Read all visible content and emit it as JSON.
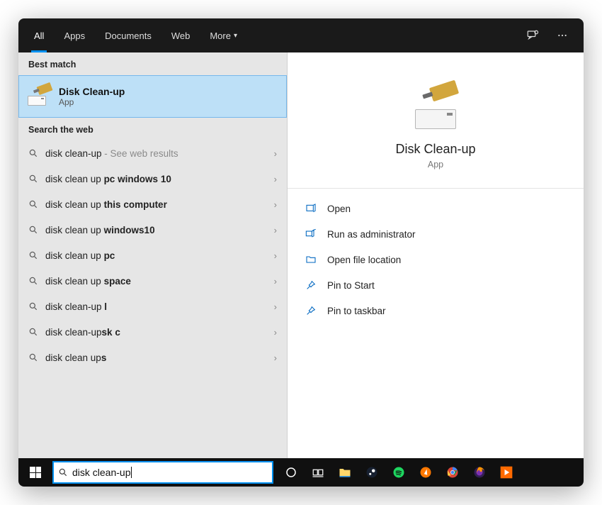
{
  "tabs": {
    "items": [
      "All",
      "Apps",
      "Documents",
      "Web",
      "More"
    ],
    "active_index": 0
  },
  "left": {
    "best_label": "Best match",
    "best": {
      "title": "Disk Clean-up",
      "sub": "App"
    },
    "web_label": "Search the web",
    "suggestions": [
      {
        "pre": "disk clean-up",
        "bold": "",
        "hint": " - See web results"
      },
      {
        "pre": "disk clean up ",
        "bold": "pc windows 10",
        "hint": ""
      },
      {
        "pre": "disk clean up ",
        "bold": "this computer",
        "hint": ""
      },
      {
        "pre": "disk clean up ",
        "bold": "windows10",
        "hint": ""
      },
      {
        "pre": "disk clean up ",
        "bold": "pc",
        "hint": ""
      },
      {
        "pre": "disk clean up ",
        "bold": "space",
        "hint": ""
      },
      {
        "pre": "disk clean-up ",
        "bold": "l",
        "hint": ""
      },
      {
        "pre": "disk clean-up",
        "bold": "sk c",
        "hint": ""
      },
      {
        "pre": "disk clean up",
        "bold": "s",
        "hint": ""
      }
    ]
  },
  "right": {
    "title": "Disk Clean-up",
    "sub": "App",
    "actions": [
      {
        "icon": "open",
        "label": "Open"
      },
      {
        "icon": "admin",
        "label": "Run as administrator"
      },
      {
        "icon": "folder",
        "label": "Open file location"
      },
      {
        "icon": "pin",
        "label": "Pin to Start"
      },
      {
        "icon": "pin",
        "label": "Pin to taskbar"
      }
    ]
  },
  "taskbar": {
    "search_value": "disk clean-up",
    "icons": [
      "cortana",
      "taskview",
      "explorer",
      "steam",
      "spotify",
      "avast",
      "chrome",
      "firefox",
      "groove"
    ]
  }
}
